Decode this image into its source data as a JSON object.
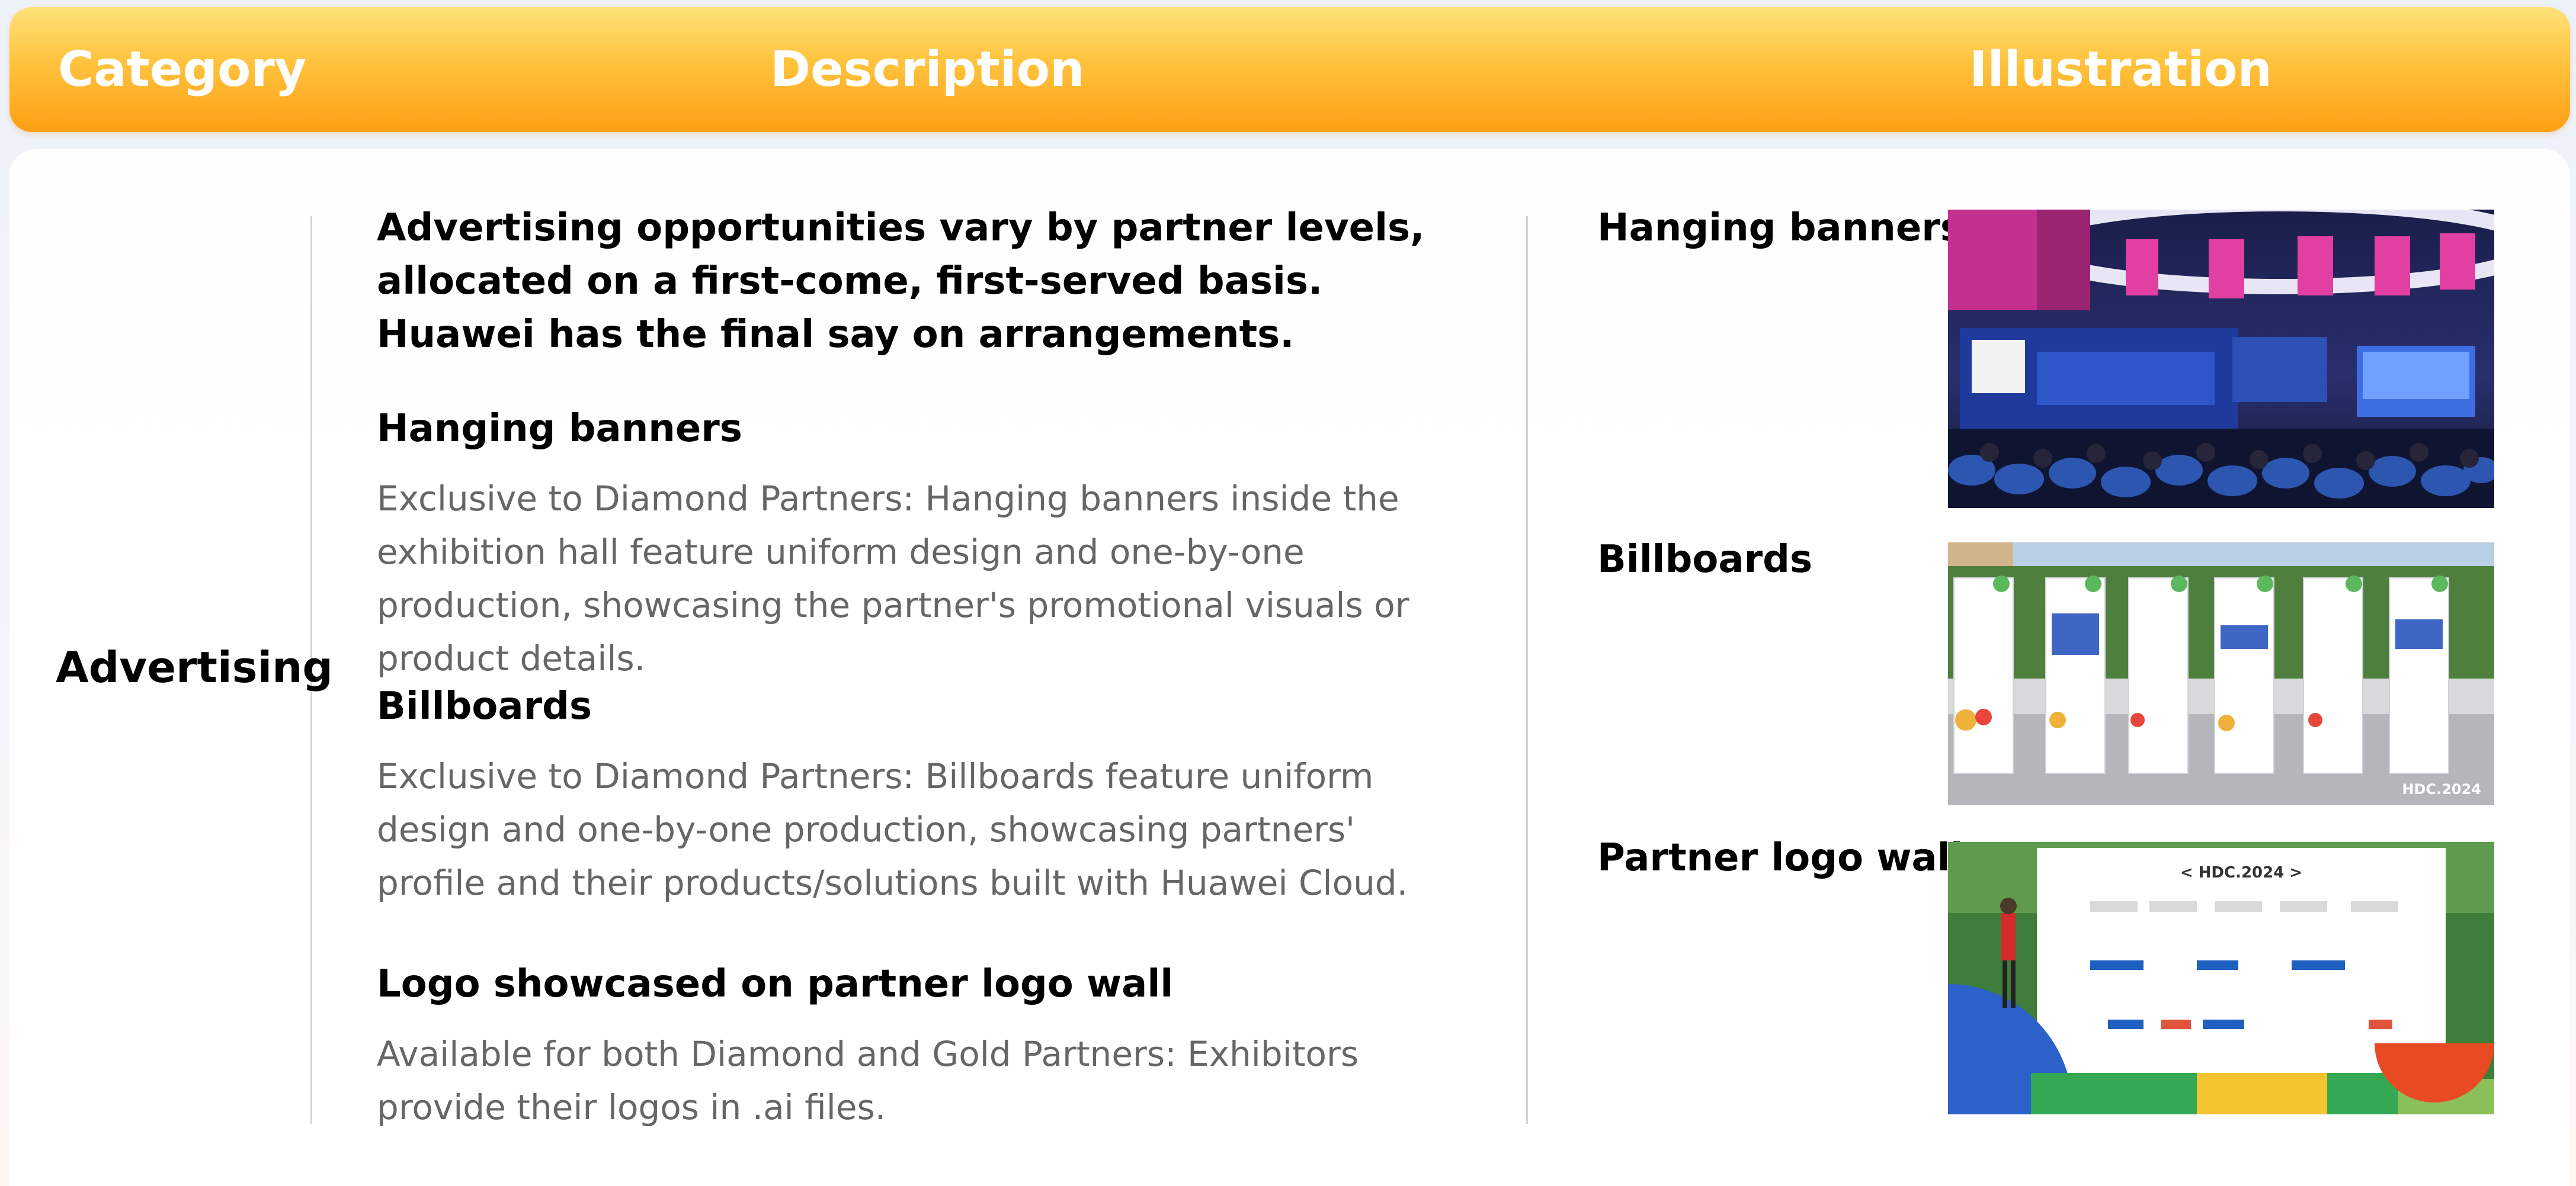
{
  "header": {
    "category": "Category",
    "description": "Description",
    "illustration": "Illustration"
  },
  "category": "Advertising",
  "description": {
    "lead": "Advertising opportunities vary by partner levels, allocated on a first-come, first-served basis. Huawei has the final say on arrangements.",
    "sections": [
      {
        "title": "Hanging banners",
        "body": "Exclusive to Diamond Partners: Hanging banners inside the exhibition hall feature uniform design and one-by-one production, showcasing the partner's promotional visuals or product details."
      },
      {
        "title": "Billboards",
        "body": "Exclusive to Diamond Partners: Billboards feature uniform design and one-by-one production, showcasing partners' profile and their products/solutions built with Huawei Cloud."
      },
      {
        "title": "Logo showcased on partner logo wall",
        "body": "Available for both Diamond and Gold Partners: Exhibitors provide their logos in .ai files."
      }
    ]
  },
  "illustrations": [
    {
      "label": "Hanging banners"
    },
    {
      "label": "Billboards",
      "watermark": "HDC.2024"
    },
    {
      "label": "Partner logo wall",
      "wall_title": "< HDC.2024 >"
    }
  ],
  "colors": {
    "header_top": "#ffe27a",
    "header_bottom": "#ff9f15",
    "body_text": "#666666"
  }
}
